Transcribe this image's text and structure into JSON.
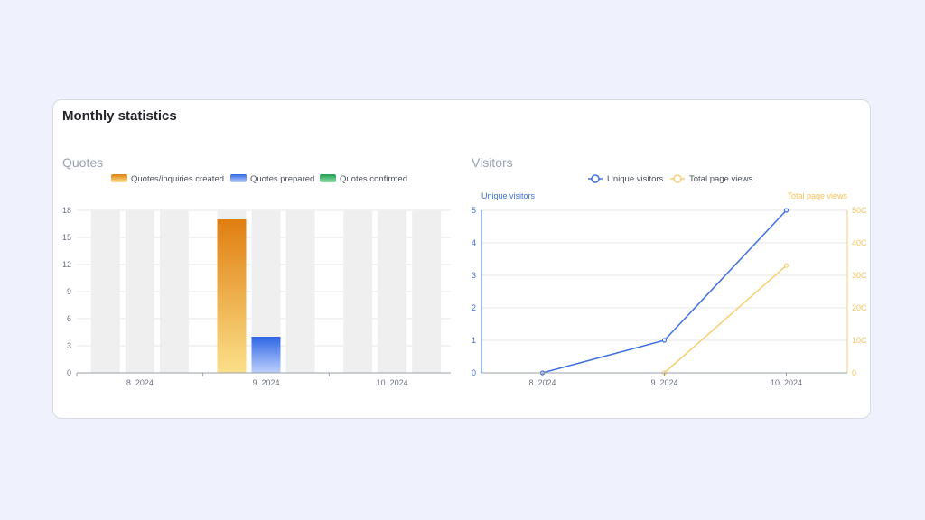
{
  "card": {
    "title": "Monthly statistics"
  },
  "chart_data": [
    {
      "type": "bar",
      "title": "Quotes",
      "categories": [
        "8. 2024",
        "9. 2024",
        "10. 2024"
      ],
      "ylim": [
        0,
        18
      ],
      "yticks": [
        "0",
        "3",
        "6",
        "9",
        "12",
        "15",
        "18"
      ],
      "series": [
        {
          "name": "Quotes/inquiries created",
          "values": [
            0,
            17,
            0
          ]
        },
        {
          "name": "Quotes prepared",
          "values": [
            0,
            4,
            0
          ]
        },
        {
          "name": "Quotes confirmed",
          "values": [
            0,
            0,
            0
          ]
        }
      ],
      "legend": "top-center",
      "grid": true
    },
    {
      "type": "line",
      "title": "Visitors",
      "x": [
        "8. 2024",
        "9. 2024",
        "10. 2024"
      ],
      "y_left": {
        "name": "Unique visitors",
        "ylim": [
          0,
          5
        ],
        "ticks": [
          "0",
          "1",
          "2",
          "3",
          "4",
          "5"
        ]
      },
      "y_right": {
        "name": "Total page views",
        "ylim": [
          0,
          500
        ],
        "ticks": [
          "0",
          "10C",
          "20C",
          "30C",
          "40C",
          "50C"
        ]
      },
      "series": [
        {
          "name": "Unique visitors",
          "axis": "left",
          "values": [
            0,
            1,
            5
          ]
        },
        {
          "name": "Total page views",
          "axis": "right",
          "values": [
            null,
            0,
            330
          ]
        }
      ],
      "legend": "top-center",
      "grid": true
    }
  ],
  "colors": {
    "orange_top": "#e07e10",
    "orange_bottom": "#fbe08a",
    "blue_top": "#2f66e6",
    "blue_bottom": "#bcd0fb",
    "green_top": "#1f9d4f",
    "green_bottom": "#8ee0ab",
    "placeholder": "#efefef",
    "line_blue": "#3e6fe0",
    "line_orange": "#f8cf73",
    "grid": "#e6e6e6"
  }
}
